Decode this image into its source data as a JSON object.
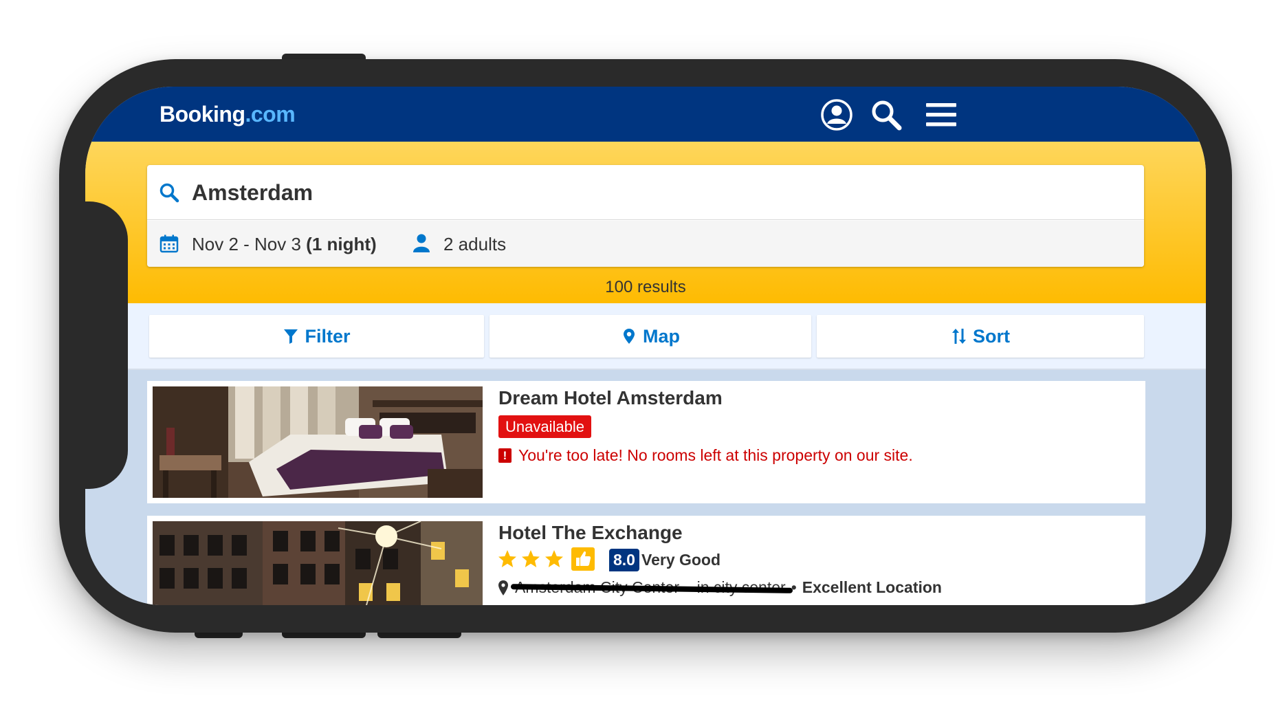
{
  "app": {
    "logo_part1": "Booking",
    "logo_part2": ".com",
    "brand_colors": {
      "header": "#003580",
      "accent": "#febb02",
      "link": "#0077cc",
      "logo_dot_com": "#59b7ff"
    }
  },
  "header": {
    "icons": [
      "account-icon",
      "search-icon",
      "menu-icon"
    ]
  },
  "search": {
    "destination": "Amsterdam",
    "dates": "Nov 2 - Nov 3 ",
    "nights": "(1 night)",
    "guests": "2 adults",
    "results": "100 results"
  },
  "actions": {
    "filter": "Filter",
    "map": "Map",
    "sort": "Sort"
  },
  "hotels": [
    {
      "name": "Dream Hotel Amsterdam",
      "badge": "Unavailable",
      "message": "You're too late! No rooms left at this property on our site."
    },
    {
      "name": "Hotel The Exchange",
      "stars": 3,
      "score": "8.0",
      "score_label": "Very Good",
      "location": "Amsterdam City Center – in city center",
      "location_tag": "Excellent Location"
    }
  ]
}
